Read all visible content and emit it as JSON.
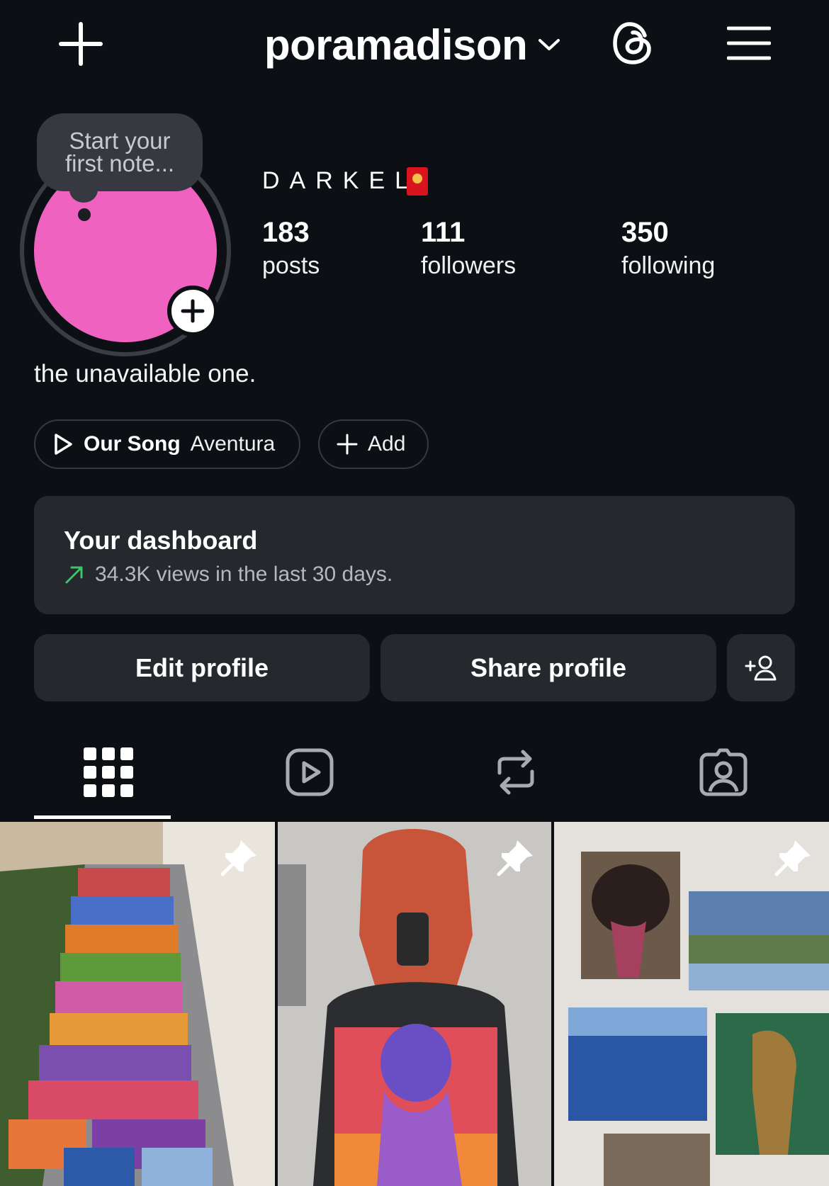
{
  "header": {
    "username": "poramadison",
    "new_post_icon": "plus-icon",
    "dropdown_icon": "chevron-down-icon",
    "threads_icon": "threads-icon",
    "menu_icon": "hamburger-menu-icon"
  },
  "profile": {
    "note_line1": "Start your",
    "note_line2": "first note...",
    "avatar_color": "#f062c0",
    "display_name": "DARKEL",
    "stats": {
      "posts_count": "183",
      "posts_label": "posts",
      "followers_count": "111",
      "followers_label": "followers",
      "following_count": "350",
      "following_label": "following"
    },
    "bio": "the unavailable one."
  },
  "chips": {
    "song_title": "Our Song",
    "song_artist": "Aventura",
    "add_label": "Add"
  },
  "dashboard": {
    "title": "Your dashboard",
    "subtitle": "34.3K views in the last 30 days.",
    "trend_color": "#3ec26b"
  },
  "actions": {
    "edit_label": "Edit profile",
    "share_label": "Share profile"
  },
  "tabs": [
    {
      "name": "posts-grid",
      "icon": "grid-icon",
      "active": true
    },
    {
      "name": "reels",
      "icon": "reels-icon",
      "active": false
    },
    {
      "name": "reposts",
      "icon": "repost-icon",
      "active": false
    },
    {
      "name": "tagged",
      "icon": "tagged-person-icon",
      "active": false
    }
  ],
  "posts": [
    {
      "pinned": true,
      "icon": "pin-icon"
    },
    {
      "pinned": true,
      "icon": "pin-icon"
    },
    {
      "pinned": true,
      "icon": "pin-icon"
    }
  ]
}
